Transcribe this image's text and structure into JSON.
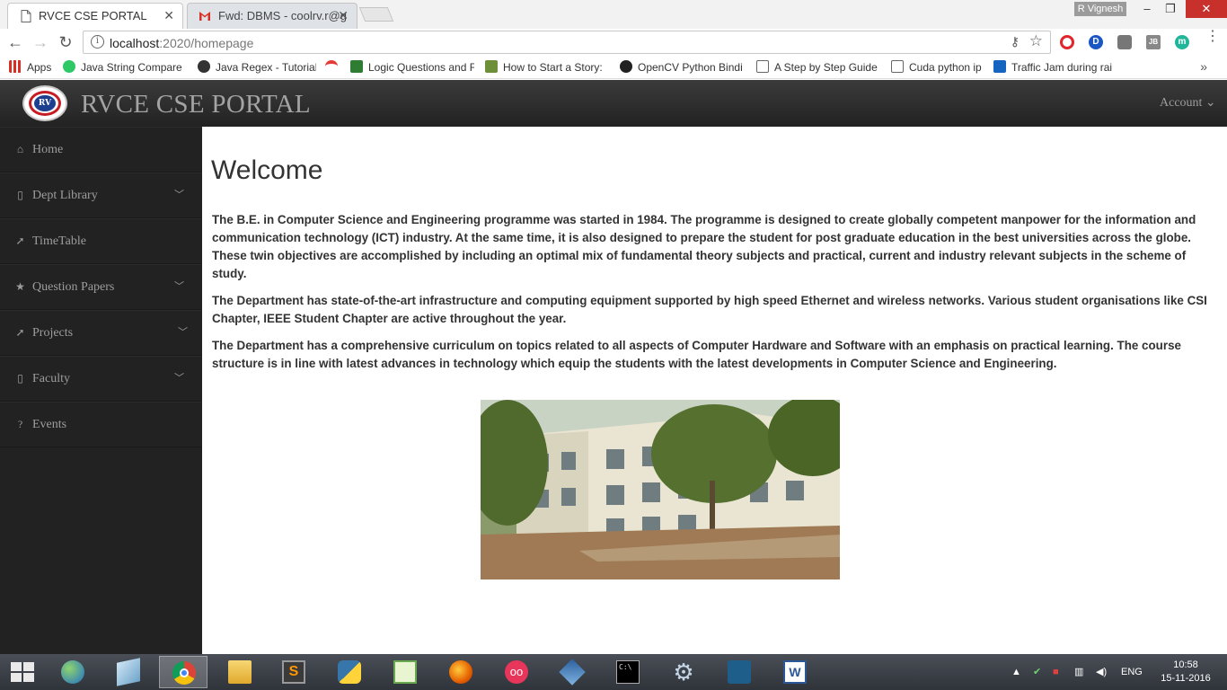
{
  "browser": {
    "tabs": [
      {
        "title": "RVCE CSE PORTAL",
        "active": true
      },
      {
        "title": "Fwd: DBMS - coolrv.r@g",
        "active": false
      }
    ],
    "user_badge": "R Vignesh",
    "window_controls": {
      "minimize": "–",
      "maximize": "❐",
      "close": "✕"
    },
    "url_host": "localhost",
    "url_path": ":2020/homepage",
    "bookmarks": [
      {
        "label": "Apps",
        "icon": "apps-grid-icon",
        "color": "#d93025"
      },
      {
        "label": "Java String Compare",
        "icon": "hackerrank-icon",
        "color": "#2ec866"
      },
      {
        "label": "Java Regex - Tutorial",
        "icon": "github-like-icon",
        "color": "#333333"
      },
      {
        "label": "",
        "icon": "red-swoosh-icon",
        "color": "#e53935"
      },
      {
        "label": "Logic Questions and F",
        "icon": "bd-icon",
        "color": "#2e7d32"
      },
      {
        "label": "How to Start a Story:",
        "icon": "h-icon",
        "color": "#6d8f3a"
      },
      {
        "label": "OpenCV Python Bindi",
        "icon": "github-icon",
        "color": "#222222"
      },
      {
        "label": "A Step by Step Guide",
        "icon": "page-icon",
        "color": "#ffffff"
      },
      {
        "label": "Cuda python ip",
        "icon": "page-icon",
        "color": "#ffffff"
      },
      {
        "label": "Traffic Jam during rai",
        "icon": "d-icon",
        "color": "#1565c0"
      }
    ],
    "bookmarks_more": "»"
  },
  "portal": {
    "brand": "RVCE CSE PORTAL",
    "logo_text": "RV",
    "account": "Account ⌄",
    "sidebar": [
      {
        "label": "Home",
        "icon": "home-icon",
        "glyph": "⌂",
        "has_children": false
      },
      {
        "label": "Dept Library",
        "icon": "book-icon",
        "glyph": "▯",
        "has_children": true
      },
      {
        "label": "TimeTable",
        "icon": "send-icon",
        "glyph": "➚",
        "has_children": false
      },
      {
        "label": "Question Papers",
        "icon": "star-icon",
        "glyph": "★",
        "has_children": true
      },
      {
        "label": "Projects",
        "icon": "send-icon",
        "glyph": "➚",
        "has_children": true
      },
      {
        "label": "Faculty",
        "icon": "person-icon",
        "glyph": "▯",
        "has_children": true
      },
      {
        "label": "Events",
        "icon": "question-circle-icon",
        "glyph": "?",
        "has_children": false
      }
    ],
    "heading": "Welcome",
    "paragraphs": [
      "The B.E. in Computer Science and Engineering programme was started in 1984. The programme is designed to create globally competent manpower for the information and communication technology (ICT) industry. At the same time, it is also designed to prepare the student for post graduate education in the best universities across the globe. These twin objectives are accomplished by including an optimal mix of fundamental theory subjects and practical, current and industry relevant subjects in the scheme of study.",
      "The Department has state-of-the-art infrastructure and computing equipment supported by high speed Ethernet and wireless networks. Various student organisations like CSI Chapter, IEEE Student Chapter are active throughout the year.",
      "The Department has a comprehensive curriculum on topics related to all aspects of Computer Hardware and Software with an emphasis on practical learning. The course structure is in line with latest advances in technology which equip the students with the latest developments in Computer Science and Engineering."
    ],
    "photo_label": "department-building-photo"
  },
  "taskbar": {
    "apps": [
      {
        "name": "network-globe-icon"
      },
      {
        "name": "notepad-icon"
      },
      {
        "name": "chrome-icon",
        "active": true
      },
      {
        "name": "file-explorer-icon"
      },
      {
        "name": "sublime-text-icon"
      },
      {
        "name": "python-icon"
      },
      {
        "name": "notepad-plus-icon"
      },
      {
        "name": "firefox-icon"
      },
      {
        "name": "flickr-dots-icon"
      },
      {
        "name": "virtualbox-icon"
      },
      {
        "name": "command-prompt-icon"
      },
      {
        "name": "settings-gear-icon"
      },
      {
        "name": "mysql-workbench-icon"
      },
      {
        "name": "word-icon"
      }
    ],
    "language": "ENG",
    "time": "10:58",
    "date": "15-11-2016"
  },
  "colors": {
    "navbar": "#222222",
    "sidebar": "#222222",
    "sidebar_text": "#9d9d9d",
    "body_text": "#333333"
  }
}
